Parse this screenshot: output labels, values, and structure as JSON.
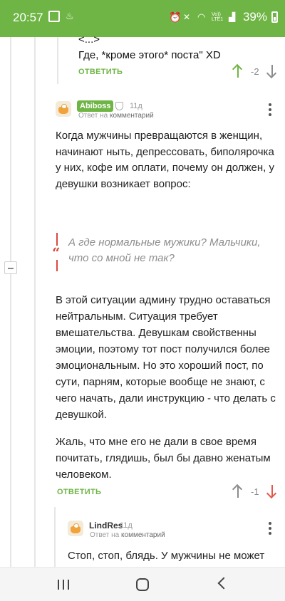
{
  "status_bar": {
    "time": "20:57",
    "network": "Vo)) LTE1",
    "battery_percent": "39%"
  },
  "prev_comment": {
    "lines": [
      "<...>",
      "Где, *кроме этого* поста\" XD"
    ],
    "reply_label": "ОТВЕТИТЬ",
    "rating": "-2"
  },
  "comment_main": {
    "author": "Abiboss",
    "age": "11д",
    "meta_prefix": "Ответ на",
    "meta_link": "комментарий",
    "paragraph1": "Когда мужчины превращаются в женщин, начинают ныть, депрессовать, биполярочка у них, кофе им оплати, почему он должен, у девушки возникает вопрос:",
    "quote": "А где нормальные мужики? Мальчики, что со мной не так?",
    "quote_mark": "“",
    "paragraph2": "В этой ситуации админу трудно оставаться нейтральным. Ситуация требует вмешательства. Девушкам свойственны эмоции, поэтому тот пост получился более эмоциональным. Но это хороший пост, по сути, парням, которые вообще не знают, с чего начать, дали инструкцию - что делать с девушкой.",
    "paragraph3": "Жаль, что мне его не дали в свое время почитать, глядишь, был бы давно женатым человеком.",
    "reply_label": "ОТВЕТИТЬ",
    "rating": "-1"
  },
  "comment_reply": {
    "author": "LindRes",
    "age": "11д",
    "meta_prefix": "Ответ на",
    "meta_link": "комментарий",
    "text": "Стоп, стоп, блядь. У мужчины не может"
  },
  "colors": {
    "brand_green": "#6fb545",
    "downvote_red": "#e1584b",
    "quote_red": "#d94a40"
  },
  "icons": [
    "image-icon",
    "notification-icon",
    "alarm-icon",
    "mute-icon",
    "wifi-icon",
    "signal-icon",
    "battery-icon",
    "shield-icon",
    "kebab-menu-icon",
    "upvote-icon",
    "downvote-icon",
    "recent-apps-icon",
    "home-icon",
    "back-icon"
  ]
}
